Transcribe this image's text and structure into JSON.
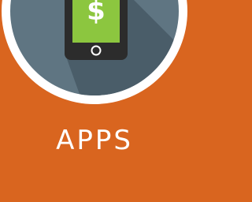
{
  "tile": {
    "title": "APPS",
    "icon": "mobile-payment-icon",
    "screen_symbol": "$"
  },
  "colors": {
    "background": "#d9651f",
    "ring": "#ffffff",
    "badge_face": "#5f7582",
    "badge_shadow": "#4a5d69",
    "phone_body": "#2c2c2c",
    "phone_screen": "#8cc63f",
    "title_text": "#ffffff"
  }
}
